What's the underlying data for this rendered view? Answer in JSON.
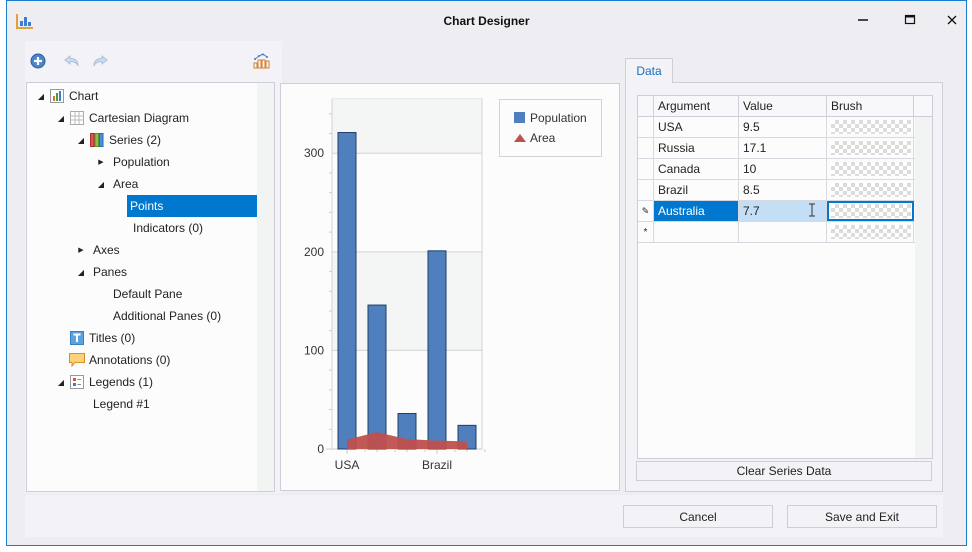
{
  "window": {
    "title": "Chart Designer",
    "app_icon": "chart-designer-icon",
    "controls": {
      "minimize": "minimize-icon",
      "maximize": "maximize-icon",
      "close": "close-icon"
    }
  },
  "toolbar": {
    "add": "add-icon",
    "undo": "undo-icon",
    "redo": "redo-icon",
    "chart_type": "chart-type-icon"
  },
  "tree": {
    "items": [
      {
        "label": "Chart",
        "level": 0,
        "expanded": true,
        "icon": "chart-icon"
      },
      {
        "label": "Cartesian Diagram",
        "level": 1,
        "expanded": true,
        "icon": "diagram-grid-icon"
      },
      {
        "label": "Series (2)",
        "level": 2,
        "expanded": true,
        "icon": "series-icon"
      },
      {
        "label": "Population",
        "level": 3,
        "expanded": false,
        "icon": ""
      },
      {
        "label": "Area",
        "level": 3,
        "expanded": true,
        "icon": ""
      },
      {
        "label": "Points",
        "level": 4,
        "selected": true,
        "icon": ""
      },
      {
        "label": "Indicators (0)",
        "level": 4,
        "icon": ""
      },
      {
        "label": "Axes",
        "level": 2,
        "expanded": false,
        "icon": ""
      },
      {
        "label": "Panes",
        "level": 2,
        "expanded": true,
        "icon": ""
      },
      {
        "label": "Default Pane",
        "level": 3,
        "icon": ""
      },
      {
        "label": "Additional Panes (0)",
        "level": 3,
        "icon": ""
      },
      {
        "label": "Titles (0)",
        "level": 1,
        "icon": "titles-icon"
      },
      {
        "label": "Annotations (0)",
        "level": 1,
        "icon": "annotations-icon"
      },
      {
        "label": "Legends (1)",
        "level": 1,
        "expanded": true,
        "icon": "legends-icon"
      },
      {
        "label": "Legend #1",
        "level": 2,
        "icon": ""
      }
    ]
  },
  "chart_data": {
    "type": "bar",
    "categories": [
      "USA",
      "Russia",
      "Canada",
      "Brazil",
      "Australia"
    ],
    "series": [
      {
        "name": "Population",
        "type": "bar",
        "color": "#4f7fbd",
        "values": [
          321,
          146,
          36,
          201,
          24
        ]
      },
      {
        "name": "Area",
        "type": "area",
        "color": "#c0504d",
        "values": [
          9.5,
          17.1,
          10,
          8.5,
          7.7
        ]
      }
    ],
    "x_tick_labels": [
      "USA",
      "Brazil"
    ],
    "y_ticks": [
      0,
      100,
      200,
      300
    ],
    "ylim": [
      0,
      355
    ],
    "grid": true,
    "legend": {
      "position": "top-right",
      "entries": [
        "Population",
        "Area"
      ]
    },
    "title": "",
    "xlabel": "",
    "ylabel": ""
  },
  "data_tab": {
    "tab_label": "Data",
    "columns": [
      "Argument",
      "Value",
      "Brush"
    ],
    "rows": [
      {
        "argument": "USA",
        "value": "9.5"
      },
      {
        "argument": "Russia",
        "value": "17.1"
      },
      {
        "argument": "Canada",
        "value": "10"
      },
      {
        "argument": "Brazil",
        "value": "8.5"
      },
      {
        "argument": "Australia",
        "value": "7.7",
        "editing": true
      }
    ],
    "new_row_indicator": "*",
    "clear_button": "Clear Series Data"
  },
  "footer": {
    "cancel": "Cancel",
    "save": "Save and Exit"
  }
}
